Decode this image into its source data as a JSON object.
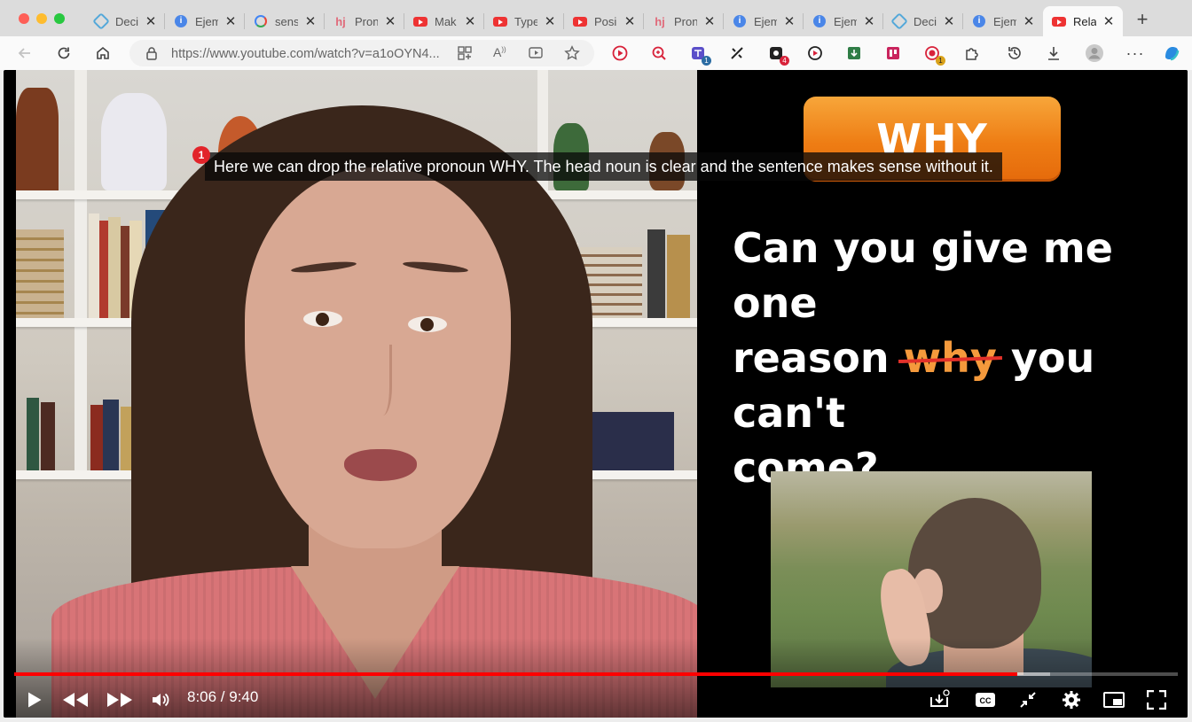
{
  "browser": {
    "tabs": [
      {
        "favicon": "deck-icon",
        "title": "Deci"
      },
      {
        "favicon": "info-icon",
        "title": "Ejem"
      },
      {
        "favicon": "google-icon",
        "title": "sens"
      },
      {
        "favicon": "hj-icon",
        "title": "Pron"
      },
      {
        "favicon": "youtube-icon",
        "title": "Mak"
      },
      {
        "favicon": "youtube-icon",
        "title": "Type"
      },
      {
        "favicon": "youtube-icon",
        "title": "Posi"
      },
      {
        "favicon": "hj-icon",
        "title": "Pron"
      },
      {
        "favicon": "info-icon",
        "title": "Ejem"
      },
      {
        "favicon": "info-icon",
        "title": "Ejem"
      },
      {
        "favicon": "deck-icon",
        "title": "Deci"
      },
      {
        "favicon": "info-icon",
        "title": "Ejem"
      },
      {
        "favicon": "youtube-icon",
        "title": "Rela",
        "active": true
      }
    ],
    "address_url_host": "https://www.youtube.com",
    "address_url_path": "/watch?v=a1oOYN4...",
    "extension_badges": {
      "ext1": "1",
      "ext2": "4",
      "ext3": "1"
    }
  },
  "video": {
    "slide": {
      "heading": "WHY",
      "sentence_line1": "Can you give me one",
      "sentence_reason": "reason ",
      "sentence_struck": "why",
      "sentence_rest": " you can't",
      "sentence_line3": "come?"
    },
    "caption": {
      "badge": "1",
      "text": "Here we can drop the relative pronoun WHY. The head noun is clear and the sentence makes sense without it."
    },
    "player": {
      "time": "8:06 / 9:40",
      "progress_played": 0.862,
      "progress_loaded": 0.89
    }
  },
  "colors": {
    "accent": "#ff0000",
    "why_orange": "#ee7d14"
  }
}
